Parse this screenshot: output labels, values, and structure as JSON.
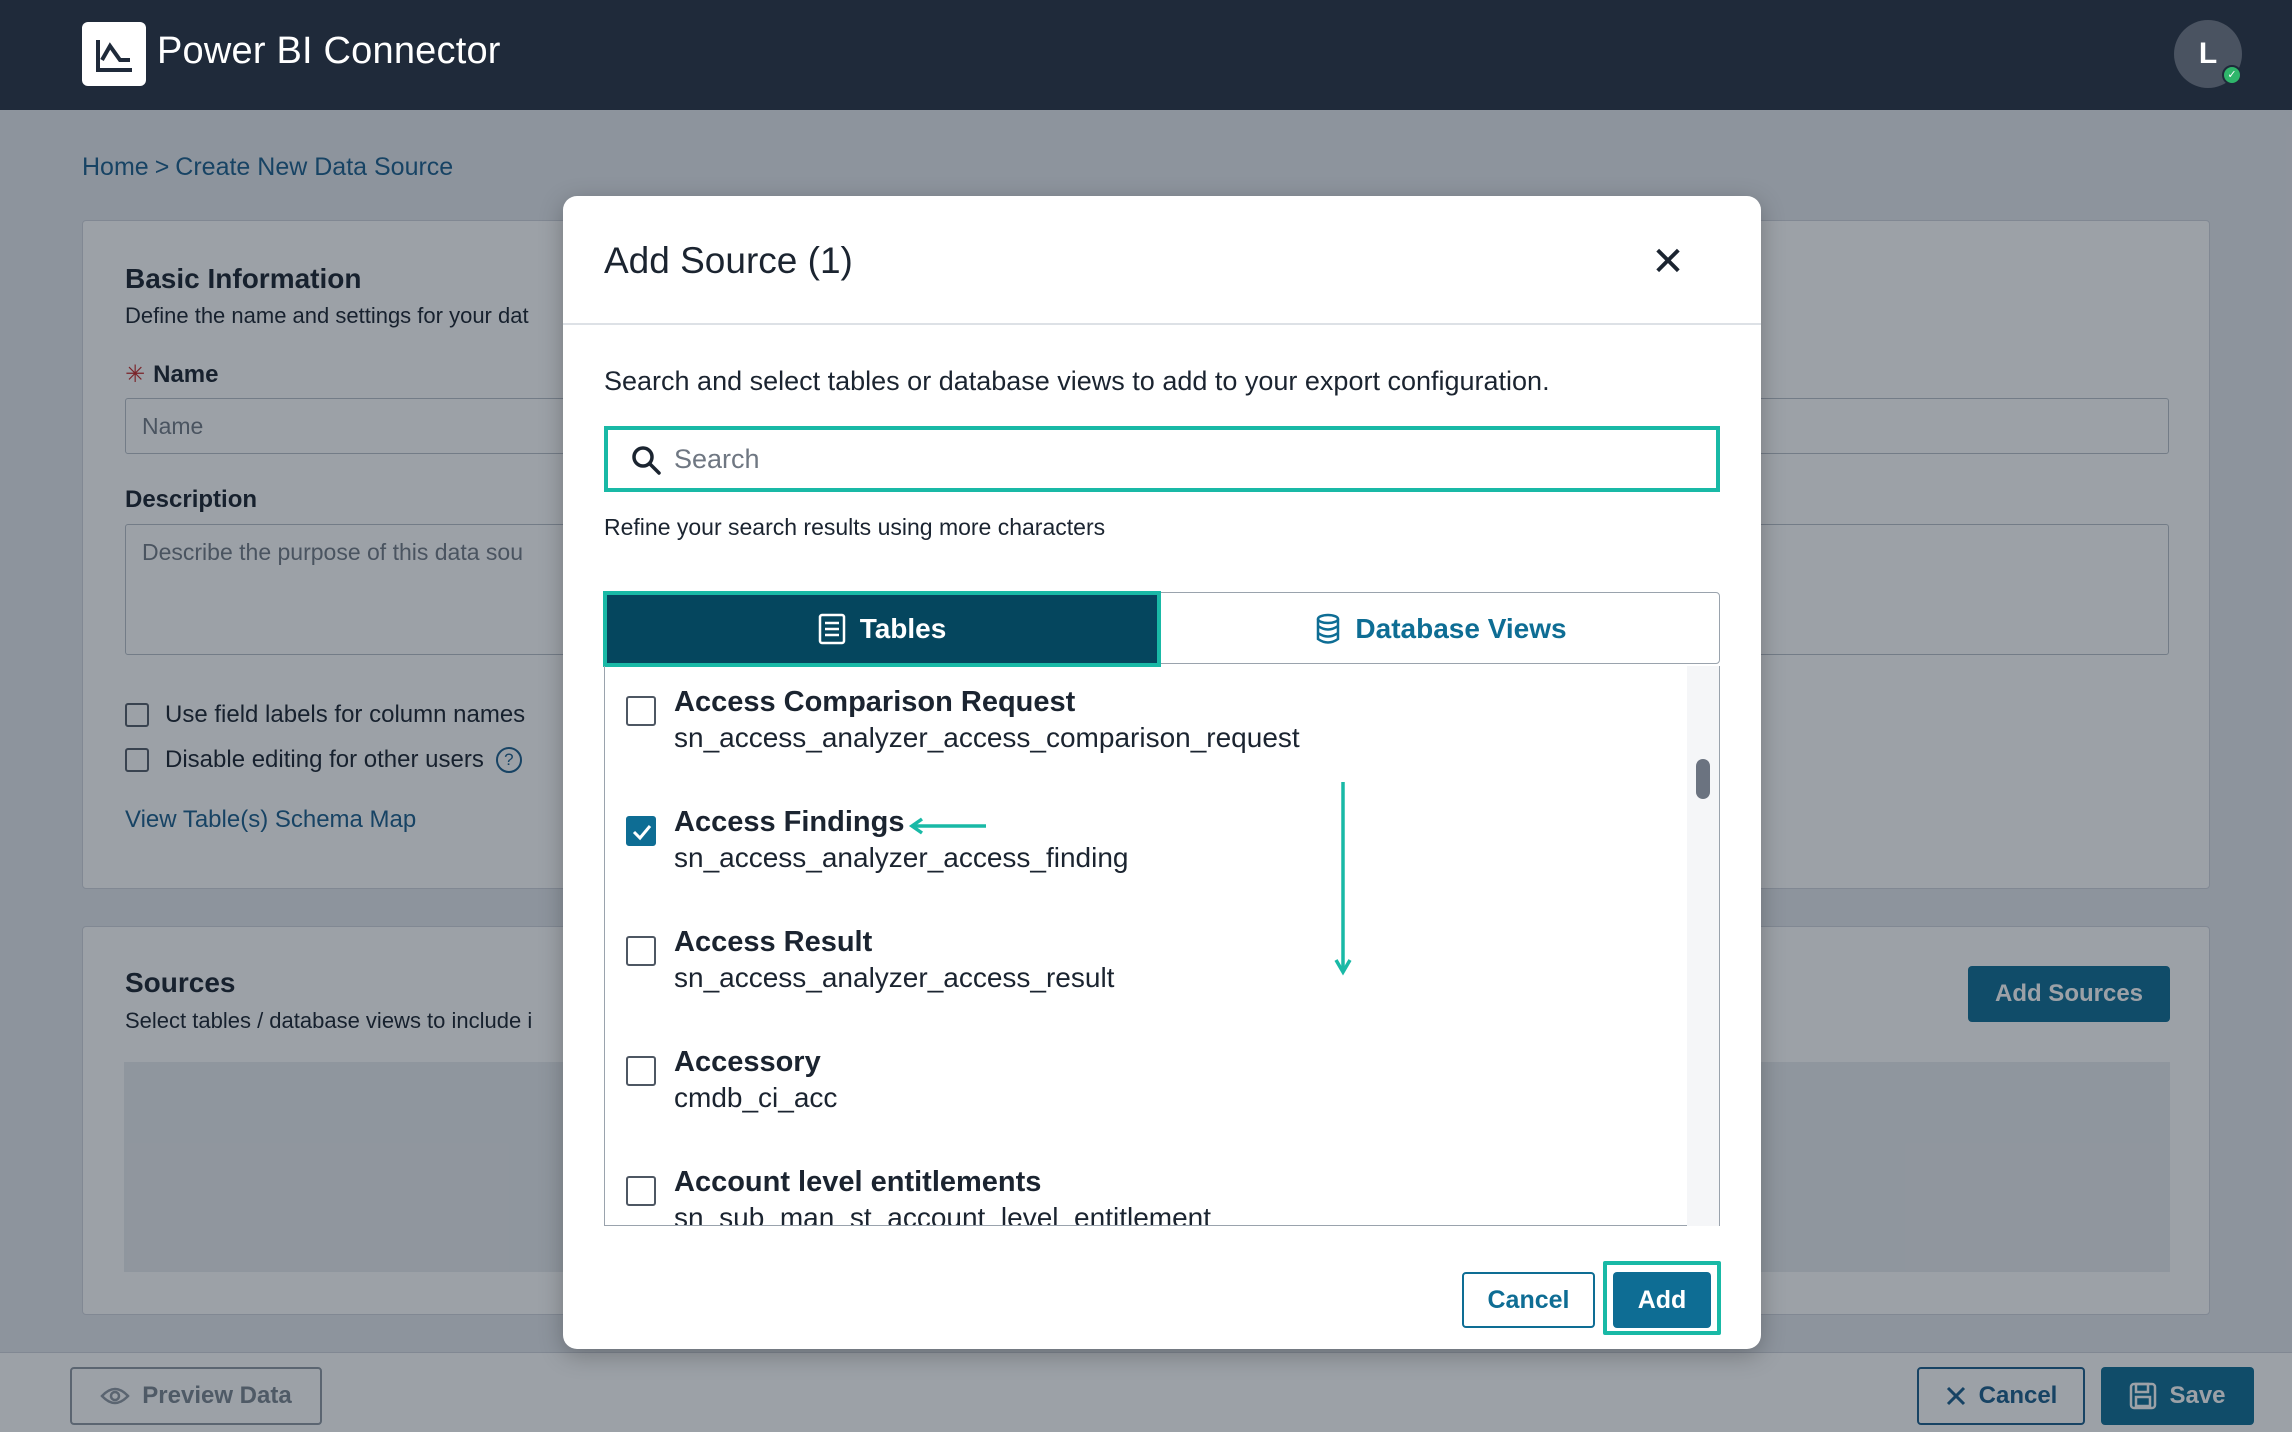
{
  "app": {
    "title": "Power BI Connector",
    "logo_icon": "chart-line-icon"
  },
  "user": {
    "avatar_initial": "L",
    "status": "online"
  },
  "breadcrumb": {
    "home": "Home",
    "separator": ">",
    "current": "Create New Data Source"
  },
  "basic_info": {
    "title": "Basic Information",
    "subtitle": "Define the name and settings for your dat",
    "name_required_mark": "✳",
    "name_label": "Name",
    "name_placeholder": "Name",
    "description_label": "Description",
    "description_placeholder": "Describe the purpose of this data sou",
    "use_field_labels": "Use field labels for column names",
    "disable_editing": "Disable editing for other users",
    "help_glyph": "?",
    "schema_map_link": "View Table(s) Schema Map"
  },
  "sources": {
    "title": "Sources",
    "subtitle": "Select tables / database views to include i",
    "add_sources_label": "Add Sources"
  },
  "footer": {
    "preview_label": "Preview Data",
    "cancel_label": "Cancel",
    "save_label": "Save"
  },
  "modal": {
    "title": "Add Source (1)",
    "close_glyph": "✕",
    "description": "Search and select tables or database views to add to your export configuration.",
    "search_placeholder": "Search",
    "refine_hint": "Refine your search results using more characters",
    "tabs": [
      {
        "label": "Tables",
        "icon": "table-list-icon",
        "active": true
      },
      {
        "label": "Database Views",
        "icon": "database-icon",
        "active": false
      }
    ],
    "items": [
      {
        "name": "Access Comparison Request",
        "code": "sn_access_analyzer_access_comparison_request",
        "checked": false
      },
      {
        "name": "Access Findings",
        "code": "sn_access_analyzer_access_finding",
        "checked": true
      },
      {
        "name": "Access Result",
        "code": "sn_access_analyzer_access_result",
        "checked": false
      },
      {
        "name": "Accessory",
        "code": "cmdb_ci_acc",
        "checked": false
      },
      {
        "name": "Account level entitlements",
        "code": "sn_sub_man_st_account_level_entitlement",
        "checked": false
      }
    ],
    "cancel_label": "Cancel",
    "add_label": "Add"
  },
  "colors": {
    "header": "#1f2a3a",
    "accent": "#0e6d94",
    "highlight": "#19b9a6",
    "active_tab": "#05465e"
  }
}
